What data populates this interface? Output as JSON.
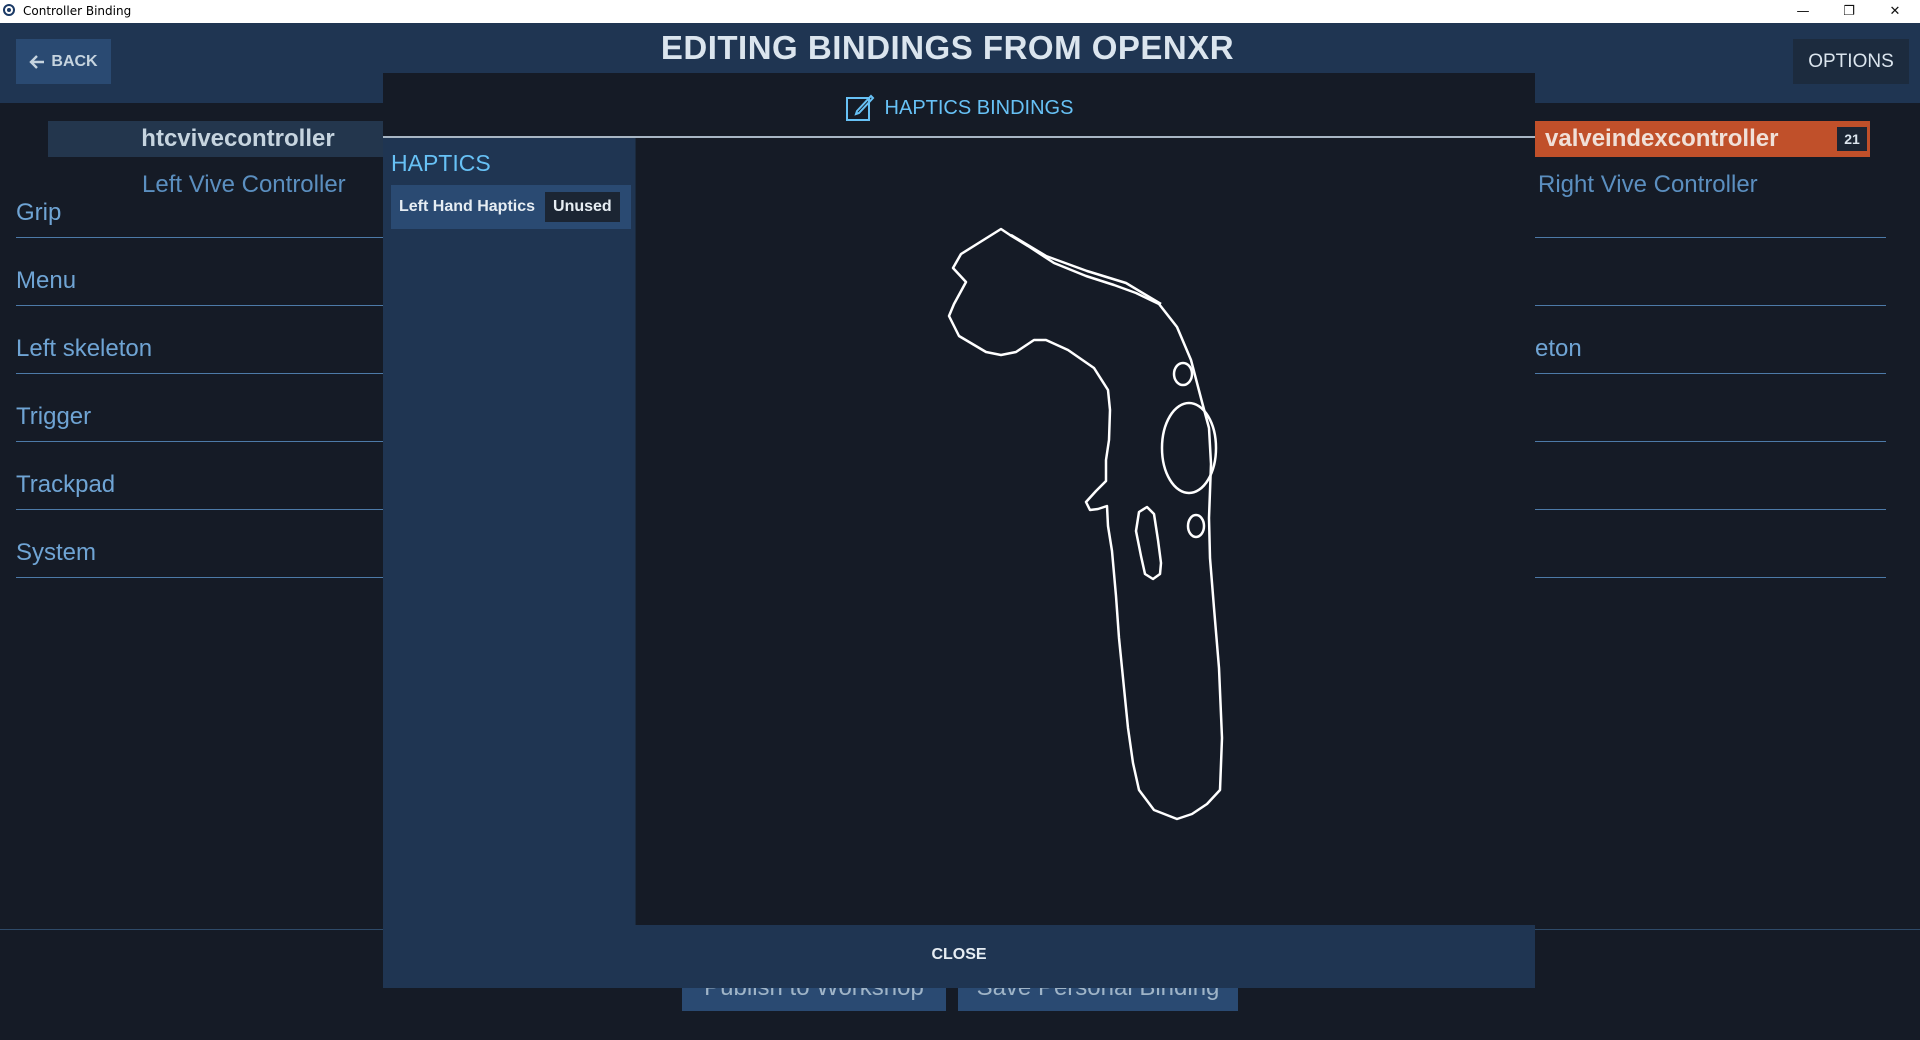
{
  "window": {
    "title": "Controller Binding",
    "controls": {
      "minimize": "—",
      "restore": "❐",
      "close": "✕"
    }
  },
  "header": {
    "back_label": "BACK",
    "title": "EDITING BINDINGS FROM OPENXR",
    "options_label": "OPTIONS"
  },
  "background": {
    "left_controller": "htcvivecontroller",
    "right_controller": "valveindexcontroller",
    "right_count": "21",
    "left_heading": "Left Vive Controller",
    "right_heading": "Right Vive Controller",
    "left_actions": [
      "Grip",
      "Menu",
      "Left skeleton",
      "Trigger",
      "Trackpad",
      "System"
    ],
    "right_partial_action": "eton",
    "publish_label": "Publish to Workshop",
    "save_label": "Save Personal Binding"
  },
  "modal": {
    "title": "HAPTICS BINDINGS",
    "section": "HAPTICS",
    "items": [
      {
        "label": "Left Hand Haptics",
        "status": "Unused"
      }
    ],
    "close_label": "CLOSE"
  },
  "colors": {
    "accent": "#67c1f5",
    "header_bg": "#1f3552",
    "page_bg": "#151b26",
    "active_tab": "#c0502a"
  }
}
